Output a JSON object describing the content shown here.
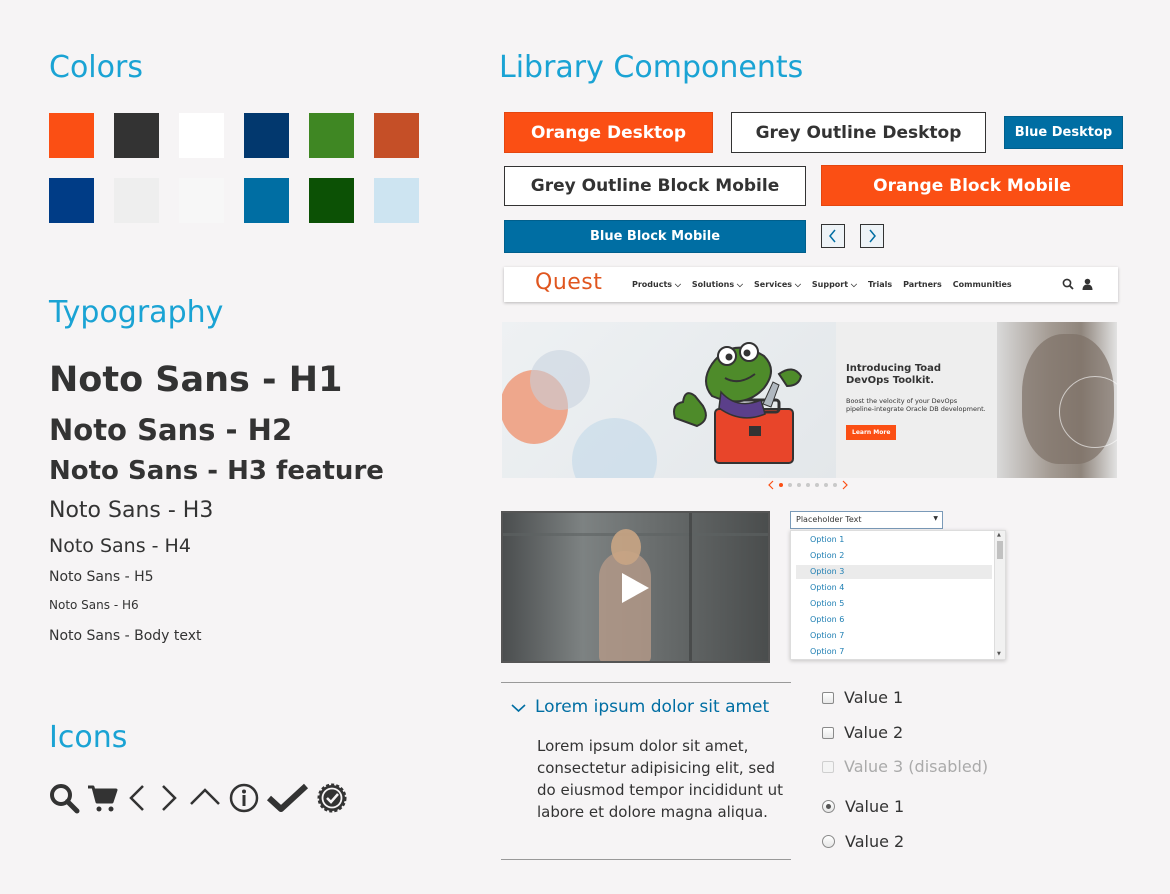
{
  "colors_section": {
    "title": "Colors",
    "swatches": [
      "#fb4f14",
      "#333333",
      "#ffffff",
      "#02386e",
      "#3f8723",
      "#c54f27",
      "#003c86",
      "#eeeeee",
      "#f7f7f7",
      "#006ea3",
      "#0c5105",
      "#cde4f1"
    ]
  },
  "typography_section": {
    "title": "Typography",
    "samples": {
      "h1": "Noto Sans - H1",
      "h2": "Noto Sans - H2",
      "h3_feature": "Noto Sans - H3 feature",
      "h3": "Noto Sans - H3",
      "h4": "Noto Sans - H4",
      "h5": "Noto Sans - H5",
      "h6": "Noto Sans - H6",
      "body": "Noto Sans - Body text"
    }
  },
  "icons_section": {
    "title": "Icons",
    "icons": [
      "search-icon",
      "cart-icon",
      "chevron-left-icon",
      "chevron-right-icon",
      "chevron-up-icon",
      "info-icon",
      "checkmark-icon",
      "badge-check-icon"
    ]
  },
  "library_section": {
    "title": "Library Components",
    "buttons": {
      "orange_desktop": "Orange Desktop",
      "grey_outline_desktop": "Grey Outline Desktop",
      "blue_desktop": "Blue Desktop",
      "grey_outline_block_mobile": "Grey Outline Block Mobile",
      "orange_block_mobile": "Orange Block Mobile",
      "blue_block_mobile": "Blue Block Mobile"
    },
    "nav": {
      "logo": "Quest",
      "items": [
        "Products",
        "Solutions",
        "Services",
        "Support",
        "Trials",
        "Partners",
        "Communities"
      ]
    },
    "hero": {
      "title": "Introducing Toad DevOps Toolkit.",
      "body": "Boost the velocity of your DevOps pipeline-integrate Oracle DB development.",
      "cta": "Learn More"
    },
    "select": {
      "placeholder": "Placeholder Text",
      "options": [
        "Option 1",
        "Option 2",
        "Option 3",
        "Option 4",
        "Option 5",
        "Option 6",
        "Option 7",
        "Option 7"
      ],
      "highlighted_index": 2
    },
    "accordion": {
      "title": "Lorem ipsum dolor sit amet",
      "body": "Lorem ipsum dolor sit amet, consectetur adipisicing elit, sed do eiusmod tempor incididunt ut labore et dolore magna aliqua."
    },
    "checkboxes": [
      "Value 1",
      "Value 2",
      "Value 3 (disabled)"
    ],
    "radios": [
      "Value 1",
      "Value 2"
    ]
  },
  "accent_colors": {
    "heading_blue": "#1aa3d4",
    "orange": "#fb4f14",
    "blue": "#006ea3"
  }
}
